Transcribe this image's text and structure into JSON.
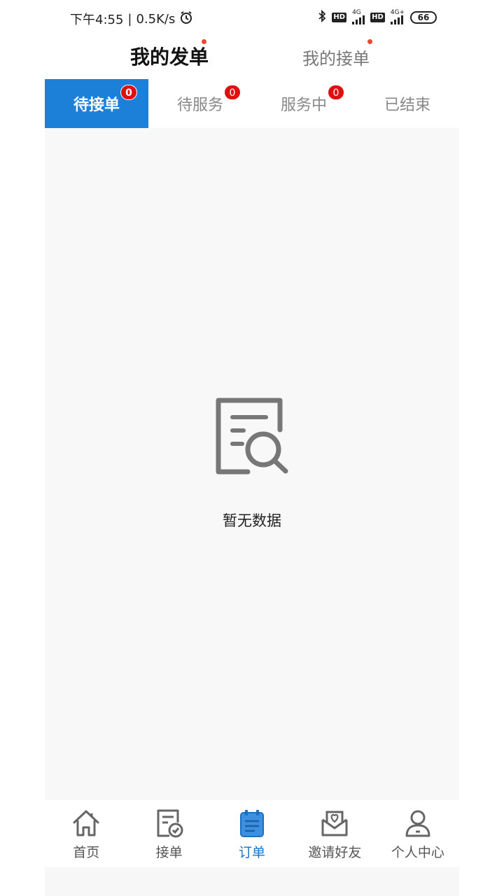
{
  "status_bar": {
    "time": "下午4:55",
    "speed": "0.5K/s",
    "network_1": "4G",
    "network_2": "4G+",
    "hd_1": "HD",
    "hd_2": "HD",
    "battery": "66"
  },
  "top_tabs": [
    {
      "label": "我的发单",
      "active": true,
      "has_dot": true
    },
    {
      "label": "我的接单",
      "active": false,
      "has_dot": true
    }
  ],
  "sub_tabs": [
    {
      "label": "待接单",
      "badge": "0",
      "active": true
    },
    {
      "label": "待服务",
      "badge": "0",
      "active": false
    },
    {
      "label": "服务中",
      "badge": "0",
      "active": false
    },
    {
      "label": "已结束",
      "active": false
    }
  ],
  "empty_state": {
    "icon": "document-search-icon",
    "text": "暂无数据"
  },
  "bottom_nav": [
    {
      "label": "首页",
      "icon": "home-icon",
      "active": false
    },
    {
      "label": "接单",
      "icon": "document-check-icon",
      "active": false
    },
    {
      "label": "订单",
      "icon": "notepad-icon",
      "active": true
    },
    {
      "label": "邀请好友",
      "icon": "invite-mail-heart-icon",
      "active": false
    },
    {
      "label": "个人中心",
      "icon": "user-icon",
      "active": false
    }
  ],
  "colors": {
    "accent": "#1c7fd8",
    "badge": "#e01010",
    "dot": "#e94a2f",
    "nav_active": "#1a73c8"
  }
}
